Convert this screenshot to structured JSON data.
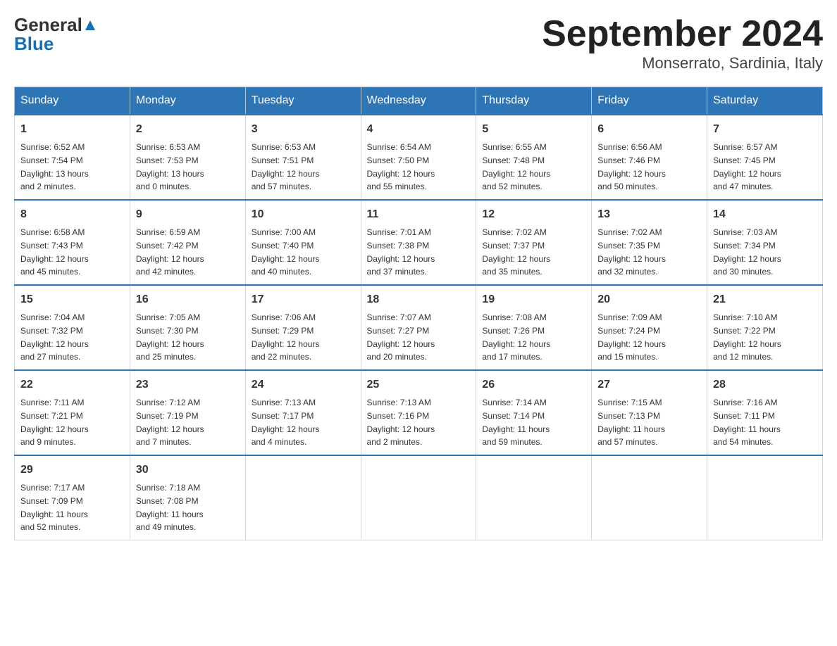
{
  "header": {
    "logo": {
      "general_text": "General",
      "blue_text": "Blue"
    },
    "title": "September 2024",
    "subtitle": "Monserrato, Sardinia, Italy"
  },
  "weekdays": [
    "Sunday",
    "Monday",
    "Tuesday",
    "Wednesday",
    "Thursday",
    "Friday",
    "Saturday"
  ],
  "weeks": [
    [
      {
        "day": "1",
        "sunrise": "6:52 AM",
        "sunset": "7:54 PM",
        "daylight": "13 hours and 2 minutes."
      },
      {
        "day": "2",
        "sunrise": "6:53 AM",
        "sunset": "7:53 PM",
        "daylight": "13 hours and 0 minutes."
      },
      {
        "day": "3",
        "sunrise": "6:53 AM",
        "sunset": "7:51 PM",
        "daylight": "12 hours and 57 minutes."
      },
      {
        "day": "4",
        "sunrise": "6:54 AM",
        "sunset": "7:50 PM",
        "daylight": "12 hours and 55 minutes."
      },
      {
        "day": "5",
        "sunrise": "6:55 AM",
        "sunset": "7:48 PM",
        "daylight": "12 hours and 52 minutes."
      },
      {
        "day": "6",
        "sunrise": "6:56 AM",
        "sunset": "7:46 PM",
        "daylight": "12 hours and 50 minutes."
      },
      {
        "day": "7",
        "sunrise": "6:57 AM",
        "sunset": "7:45 PM",
        "daylight": "12 hours and 47 minutes."
      }
    ],
    [
      {
        "day": "8",
        "sunrise": "6:58 AM",
        "sunset": "7:43 PM",
        "daylight": "12 hours and 45 minutes."
      },
      {
        "day": "9",
        "sunrise": "6:59 AM",
        "sunset": "7:42 PM",
        "daylight": "12 hours and 42 minutes."
      },
      {
        "day": "10",
        "sunrise": "7:00 AM",
        "sunset": "7:40 PM",
        "daylight": "12 hours and 40 minutes."
      },
      {
        "day": "11",
        "sunrise": "7:01 AM",
        "sunset": "7:38 PM",
        "daylight": "12 hours and 37 minutes."
      },
      {
        "day": "12",
        "sunrise": "7:02 AM",
        "sunset": "7:37 PM",
        "daylight": "12 hours and 35 minutes."
      },
      {
        "day": "13",
        "sunrise": "7:02 AM",
        "sunset": "7:35 PM",
        "daylight": "12 hours and 32 minutes."
      },
      {
        "day": "14",
        "sunrise": "7:03 AM",
        "sunset": "7:34 PM",
        "daylight": "12 hours and 30 minutes."
      }
    ],
    [
      {
        "day": "15",
        "sunrise": "7:04 AM",
        "sunset": "7:32 PM",
        "daylight": "12 hours and 27 minutes."
      },
      {
        "day": "16",
        "sunrise": "7:05 AM",
        "sunset": "7:30 PM",
        "daylight": "12 hours and 25 minutes."
      },
      {
        "day": "17",
        "sunrise": "7:06 AM",
        "sunset": "7:29 PM",
        "daylight": "12 hours and 22 minutes."
      },
      {
        "day": "18",
        "sunrise": "7:07 AM",
        "sunset": "7:27 PM",
        "daylight": "12 hours and 20 minutes."
      },
      {
        "day": "19",
        "sunrise": "7:08 AM",
        "sunset": "7:26 PM",
        "daylight": "12 hours and 17 minutes."
      },
      {
        "day": "20",
        "sunrise": "7:09 AM",
        "sunset": "7:24 PM",
        "daylight": "12 hours and 15 minutes."
      },
      {
        "day": "21",
        "sunrise": "7:10 AM",
        "sunset": "7:22 PM",
        "daylight": "12 hours and 12 minutes."
      }
    ],
    [
      {
        "day": "22",
        "sunrise": "7:11 AM",
        "sunset": "7:21 PM",
        "daylight": "12 hours and 9 minutes."
      },
      {
        "day": "23",
        "sunrise": "7:12 AM",
        "sunset": "7:19 PM",
        "daylight": "12 hours and 7 minutes."
      },
      {
        "day": "24",
        "sunrise": "7:13 AM",
        "sunset": "7:17 PM",
        "daylight": "12 hours and 4 minutes."
      },
      {
        "day": "25",
        "sunrise": "7:13 AM",
        "sunset": "7:16 PM",
        "daylight": "12 hours and 2 minutes."
      },
      {
        "day": "26",
        "sunrise": "7:14 AM",
        "sunset": "7:14 PM",
        "daylight": "11 hours and 59 minutes."
      },
      {
        "day": "27",
        "sunrise": "7:15 AM",
        "sunset": "7:13 PM",
        "daylight": "11 hours and 57 minutes."
      },
      {
        "day": "28",
        "sunrise": "7:16 AM",
        "sunset": "7:11 PM",
        "daylight": "11 hours and 54 minutes."
      }
    ],
    [
      {
        "day": "29",
        "sunrise": "7:17 AM",
        "sunset": "7:09 PM",
        "daylight": "11 hours and 52 minutes."
      },
      {
        "day": "30",
        "sunrise": "7:18 AM",
        "sunset": "7:08 PM",
        "daylight": "11 hours and 49 minutes."
      },
      null,
      null,
      null,
      null,
      null
    ]
  ],
  "labels": {
    "sunrise": "Sunrise:",
    "sunset": "Sunset:",
    "daylight": "Daylight:"
  }
}
